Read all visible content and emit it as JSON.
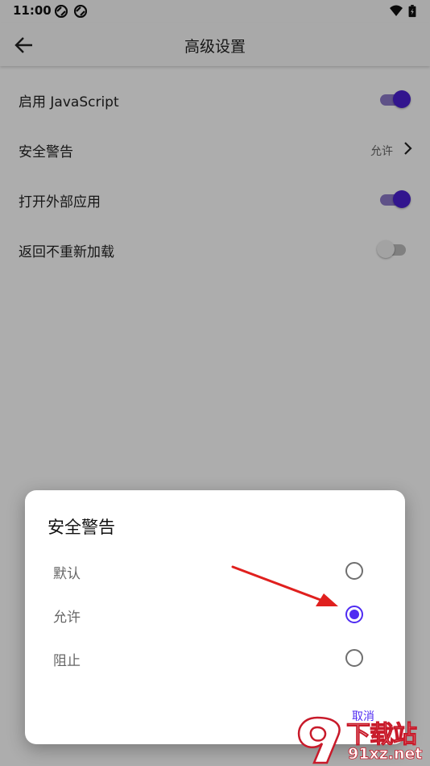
{
  "status_bar": {
    "time": "11:00",
    "left_icons": [
      "sync-icon",
      "sync-icon"
    ],
    "right_icons": [
      "wifi-icon",
      "battery-charging-icon"
    ]
  },
  "app_bar": {
    "back_icon": "arrow-left-icon",
    "title": "高级设置"
  },
  "settings": {
    "items": [
      {
        "label": "启用 JavaScript",
        "type": "switch",
        "on": true
      },
      {
        "label": "安全警告",
        "type": "value",
        "value": "允许",
        "icon": "chevron-right-icon"
      },
      {
        "label": "打开外部应用",
        "type": "switch",
        "on": true
      },
      {
        "label": "返回不重新加载",
        "type": "switch",
        "on": false
      }
    ]
  },
  "dialog": {
    "title": "安全警告",
    "options": [
      {
        "label": "默认",
        "selected": false
      },
      {
        "label": "允许",
        "selected": true
      },
      {
        "label": "阻止",
        "selected": false
      }
    ],
    "cancel_label": "取消"
  },
  "annotation": {
    "type": "arrow",
    "color": "#e0201e",
    "points_to": "允许"
  },
  "watermark": {
    "brand": "下载站",
    "url": "91xz.net",
    "color": "#c81a2a"
  },
  "colors": {
    "accent": "#4f2bf2",
    "switch_on_thumb": "#4a1fd1",
    "switch_on_track": "#8c7ac9"
  }
}
